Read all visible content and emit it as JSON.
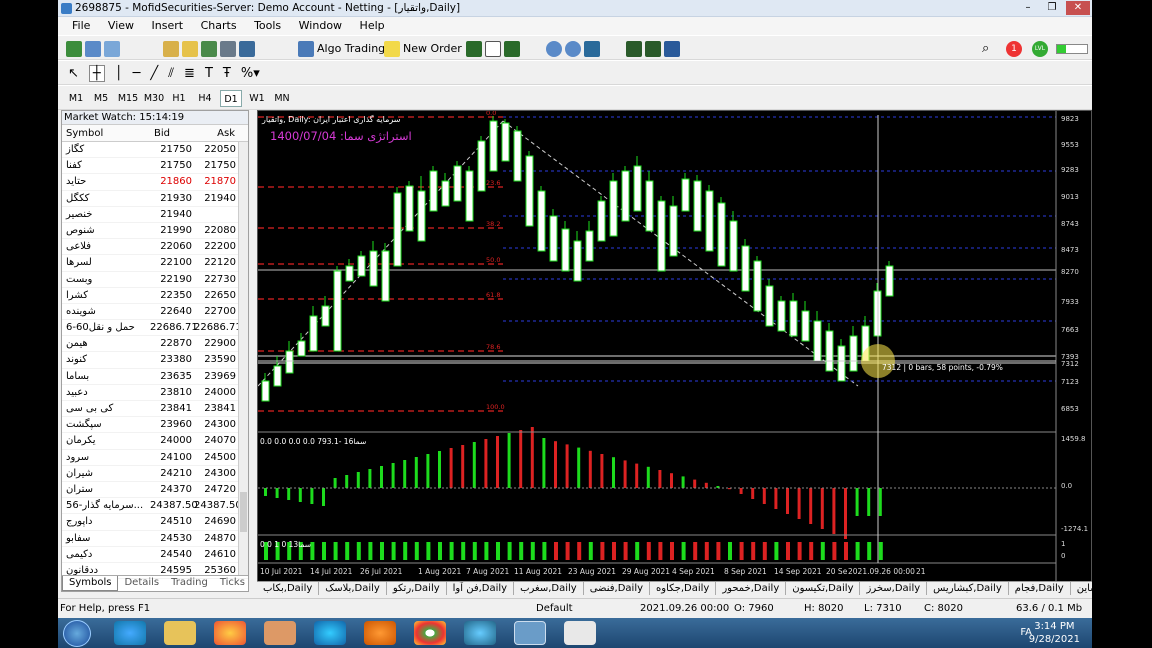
{
  "window": {
    "title": "2698875 - MofidSecurities-Server: Demo Account - Netting - [واتقیار,Daily]",
    "min": "–",
    "restore": "❐",
    "close": "✕"
  },
  "menu": [
    "File",
    "View",
    "Insert",
    "Charts",
    "Tools",
    "Window",
    "Help"
  ],
  "toolbar": {
    "algo_trading": "Algo Trading",
    "new_order": "New Order",
    "notif_count": "1",
    "signal": "LVL"
  },
  "timeframes": [
    "M1",
    "M5",
    "M15",
    "M30",
    "H1",
    "H4",
    "D1",
    "W1",
    "MN"
  ],
  "active_timeframe": "D1",
  "market_watch": {
    "title": "Market Watch: 15:14:19",
    "headers": {
      "symbol": "Symbol",
      "bid": "Bid",
      "ask": "Ask"
    },
    "rows": [
      {
        "s": "کگاز",
        "b": "21750",
        "a": "22050"
      },
      {
        "s": "کفنا",
        "b": "21750",
        "a": "21750"
      },
      {
        "s": "حتاید",
        "b": "21860",
        "a": "21870",
        "red": true
      },
      {
        "s": "ککگل",
        "b": "21930",
        "a": "21940"
      },
      {
        "s": "خنصیر",
        "b": "21940",
        "a": ""
      },
      {
        "s": "شنوص",
        "b": "21990",
        "a": "22080"
      },
      {
        "s": "فلاعی",
        "b": "22060",
        "a": "22200"
      },
      {
        "s": "لسرها",
        "b": "22100",
        "a": "22120"
      },
      {
        "s": "وبست",
        "b": "22190",
        "a": "22730"
      },
      {
        "s": "کشرا",
        "b": "22350",
        "a": "22650"
      },
      {
        "s": "شوینده",
        "b": "22640",
        "a": "22700"
      },
      {
        "s": "حمل و نقل60-6",
        "b": "22686.71",
        "a": "22686.71"
      },
      {
        "s": "هیمن",
        "b": "22870",
        "a": "22900"
      },
      {
        "s": "کنوند",
        "b": "23380",
        "a": "23590"
      },
      {
        "s": "بساما",
        "b": "23635",
        "a": "23969"
      },
      {
        "s": "دعبید",
        "b": "23810",
        "a": "24000"
      },
      {
        "s": "کی بی سی",
        "b": "23841",
        "a": "23841"
      },
      {
        "s": "سپگشت",
        "b": "23960",
        "a": "24300"
      },
      {
        "s": "یکرمان",
        "b": "24000",
        "a": "24070"
      },
      {
        "s": "سرود",
        "b": "24100",
        "a": "24500"
      },
      {
        "s": "شیران",
        "b": "24210",
        "a": "24300"
      },
      {
        "s": "ستران",
        "b": "24370",
        "a": "24720"
      },
      {
        "s": "سرمایه گذار-56...",
        "b": "24387.50",
        "a": "24387.50"
      },
      {
        "s": "داپورج",
        "b": "24510",
        "a": "24690"
      },
      {
        "s": "سفابو",
        "b": "24530",
        "a": "24870"
      },
      {
        "s": "دکیمی",
        "b": "24540",
        "a": "24610"
      },
      {
        "s": "ددقانون",
        "b": "24595",
        "a": "25360"
      }
    ],
    "tabs": [
      "Symbols",
      "Details",
      "Trading",
      "Ticks"
    ]
  },
  "chart": {
    "symbol_label": "واتقیار, Daily: سرمایه گذاری اعتبار ایران",
    "date_label": "1400/07/04 :استراتژی سما",
    "cursor_label": "7312 | 0 bars, 58 points, -0.79%",
    "fib_labels": [
      "0.0",
      "23.6",
      "38.2",
      "50.0",
      "61.8",
      "78.6",
      "100.0"
    ],
    "price_scale": [
      "9823",
      "9553",
      "9283",
      "9013",
      "8743",
      "8473",
      "8270",
      "7933",
      "7663",
      "7393",
      "7312",
      "7123",
      "6853"
    ],
    "ind1_label": "0.0 0.0 0.0 0.0 793.1- 16سما",
    "ind1_scale": [
      "1459.8",
      "0.0",
      "-1274.1"
    ],
    "ind2_label": "0 0 1 0 13سما",
    "ind2_scale": [
      "1",
      "0"
    ],
    "date_axis": [
      "10 Jul 2021",
      "14 Jul 2021",
      "26 Jul 2021",
      "1 Aug 2021",
      "7 Aug 2021",
      "11 Aug 2021",
      "23 Aug 2021",
      "29 Aug 2021",
      "4 Sep 2021",
      "8 Sep 2021",
      "14 Sep 2021",
      "20 Se",
      "2021.09.26 00:00",
      "21"
    ]
  },
  "chart_tabs": [
    "بکاب,Daily",
    "بلاسک,Daily",
    "رتکو,Daily",
    "فن آوا,Daily",
    "سغرب,Daily",
    "فنضی,Daily",
    "جکاوه,Daily",
    "خمحور,Daily",
    "تکیسون,Daily",
    "سخرز,Daily",
    "کبشاریس,Daily",
    "فجام,Daily",
    "شاین"
  ],
  "status": {
    "help": "For Help, press F1",
    "profile": "Default",
    "datetime": "2021.09.26 00:00",
    "open": "O: 7960",
    "high": "H: 8020",
    "low": "L: 7310",
    "close": "C: 8020",
    "traffic": "63.6 / 0.1 Mb"
  },
  "taskbar": {
    "lang": "FA",
    "time": "3:14 PM",
    "date": "9/28/2021"
  }
}
